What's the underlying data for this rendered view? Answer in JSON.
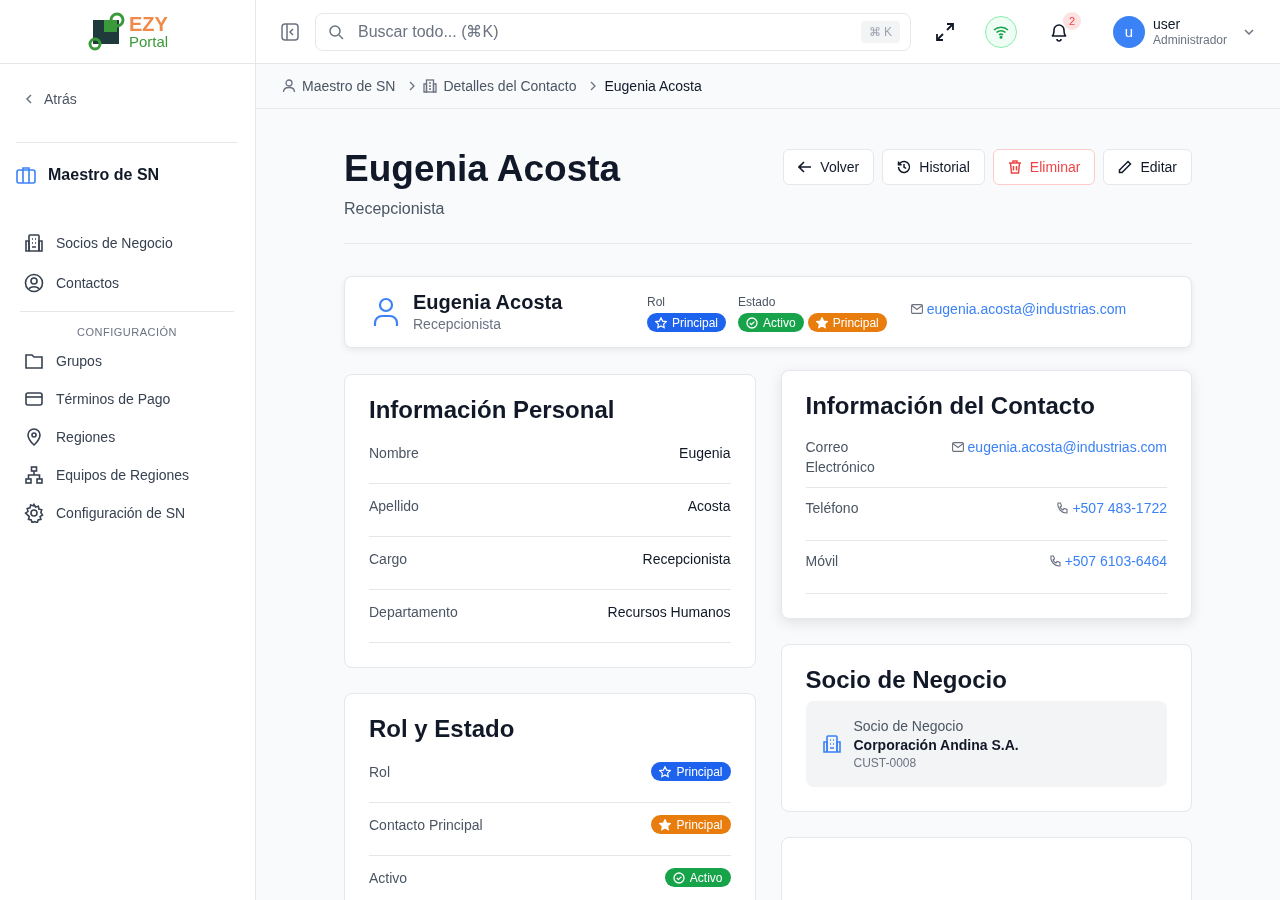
{
  "logo": {
    "line1": "EZY",
    "line2": "Portal"
  },
  "search": {
    "placeholder": "Buscar todo... (⌘K)",
    "shortcut": "⌘ K"
  },
  "notifications": {
    "count": "2"
  },
  "user": {
    "initial": "u",
    "name": "user",
    "role": "Administrador"
  },
  "sidebar": {
    "back": "Atrás",
    "title": "Maestro de SN",
    "items": [
      {
        "label": "Socios de Negocio",
        "selected": false
      },
      {
        "label": "Contactos",
        "selected": false
      }
    ],
    "section": "CONFIGURACIÓN",
    "config_items": [
      {
        "label": "Grupos",
        "selected": false
      },
      {
        "label": "Términos de Pago",
        "selected": false
      },
      {
        "label": "Regiones",
        "selected": false
      },
      {
        "label": "Equipos de Regiones",
        "selected": false
      },
      {
        "label": "Configuración de SN",
        "selected": false
      }
    ]
  },
  "breadcrumb": [
    "Maestro de SN",
    "Detalles del Contacto",
    "Eugenia Acosta"
  ],
  "page": {
    "title": "Eugenia Acosta",
    "subtitle": "Recepcionista",
    "buttons": [
      {
        "label": "Volver",
        "kind": "back"
      },
      {
        "label": "Historial",
        "kind": "history"
      },
      {
        "label": "Eliminar",
        "kind": "delete"
      },
      {
        "label": "Editar",
        "kind": "edit"
      }
    ]
  },
  "summary": {
    "name": "Eugenia Acosta",
    "position": "Recepcionista",
    "role_label": "Rol",
    "role_badges": [
      {
        "label": "Principal",
        "kind": "role"
      }
    ],
    "status_label": "Estado",
    "status_badges": [
      {
        "label": "Activo",
        "kind": "active"
      },
      {
        "label": "Principal",
        "kind": "primary"
      }
    ],
    "email": "eugenia.acosta@industrias.com"
  },
  "personal": {
    "title": "Información Personal",
    "rows": [
      {
        "label": "Nombre",
        "value": "Eugenia",
        "kind": "text"
      },
      {
        "label": "Apellido",
        "value": "Acosta",
        "kind": "text"
      },
      {
        "label": "Cargo",
        "value": "Recepcionista",
        "kind": "text"
      },
      {
        "label": "Departamento",
        "value": "Recursos Humanos",
        "kind": "text"
      }
    ]
  },
  "role_status": {
    "title": "Rol y Estado",
    "rows": [
      {
        "label": "Rol",
        "value": "Principal",
        "kind": "role"
      },
      {
        "label": "Contacto Principal",
        "value": "Principal",
        "kind": "primary"
      },
      {
        "label": "Activo",
        "value": "Activo",
        "kind": "active"
      }
    ]
  },
  "contact": {
    "title": "Información del Contacto",
    "rows": [
      {
        "label": "Correo Electrónico",
        "value": "eugenia.acosta@industrias.com",
        "kind": "email"
      },
      {
        "label": "Teléfono",
        "value": "+507 483-1722",
        "kind": "phone"
      },
      {
        "label": "Móvil",
        "value": "+507 6103-6464",
        "kind": "phone"
      }
    ]
  },
  "partner": {
    "title": "Socio de Negocio",
    "label": "Socio de Negocio",
    "name": "Corporación Andina S.A.",
    "code": "CUST-0008"
  }
}
